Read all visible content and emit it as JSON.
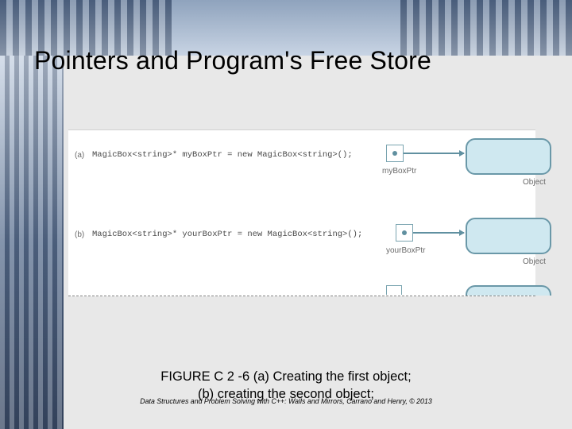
{
  "title": "Pointers and Program's Free Store",
  "figure": {
    "a": {
      "marker": "(a)",
      "code": "MagicBox<string>* myBoxPtr = new MagicBox<string>();",
      "pointer_label": "myBoxPtr",
      "object_label": "Object"
    },
    "b": {
      "marker": "(b)",
      "code": "MagicBox<string>* yourBoxPtr = new MagicBox<string>();",
      "pointer_label": "yourBoxPtr",
      "object_label": "Object"
    }
  },
  "caption_line1": "FIGURE C 2 -6 (a) Creating the first object;",
  "caption_line2": "(b) creating the second object;",
  "attribution": "Data Structures and Problem Solving with C++: Walls and Mirrors, Carrano and Henry, © 2013"
}
